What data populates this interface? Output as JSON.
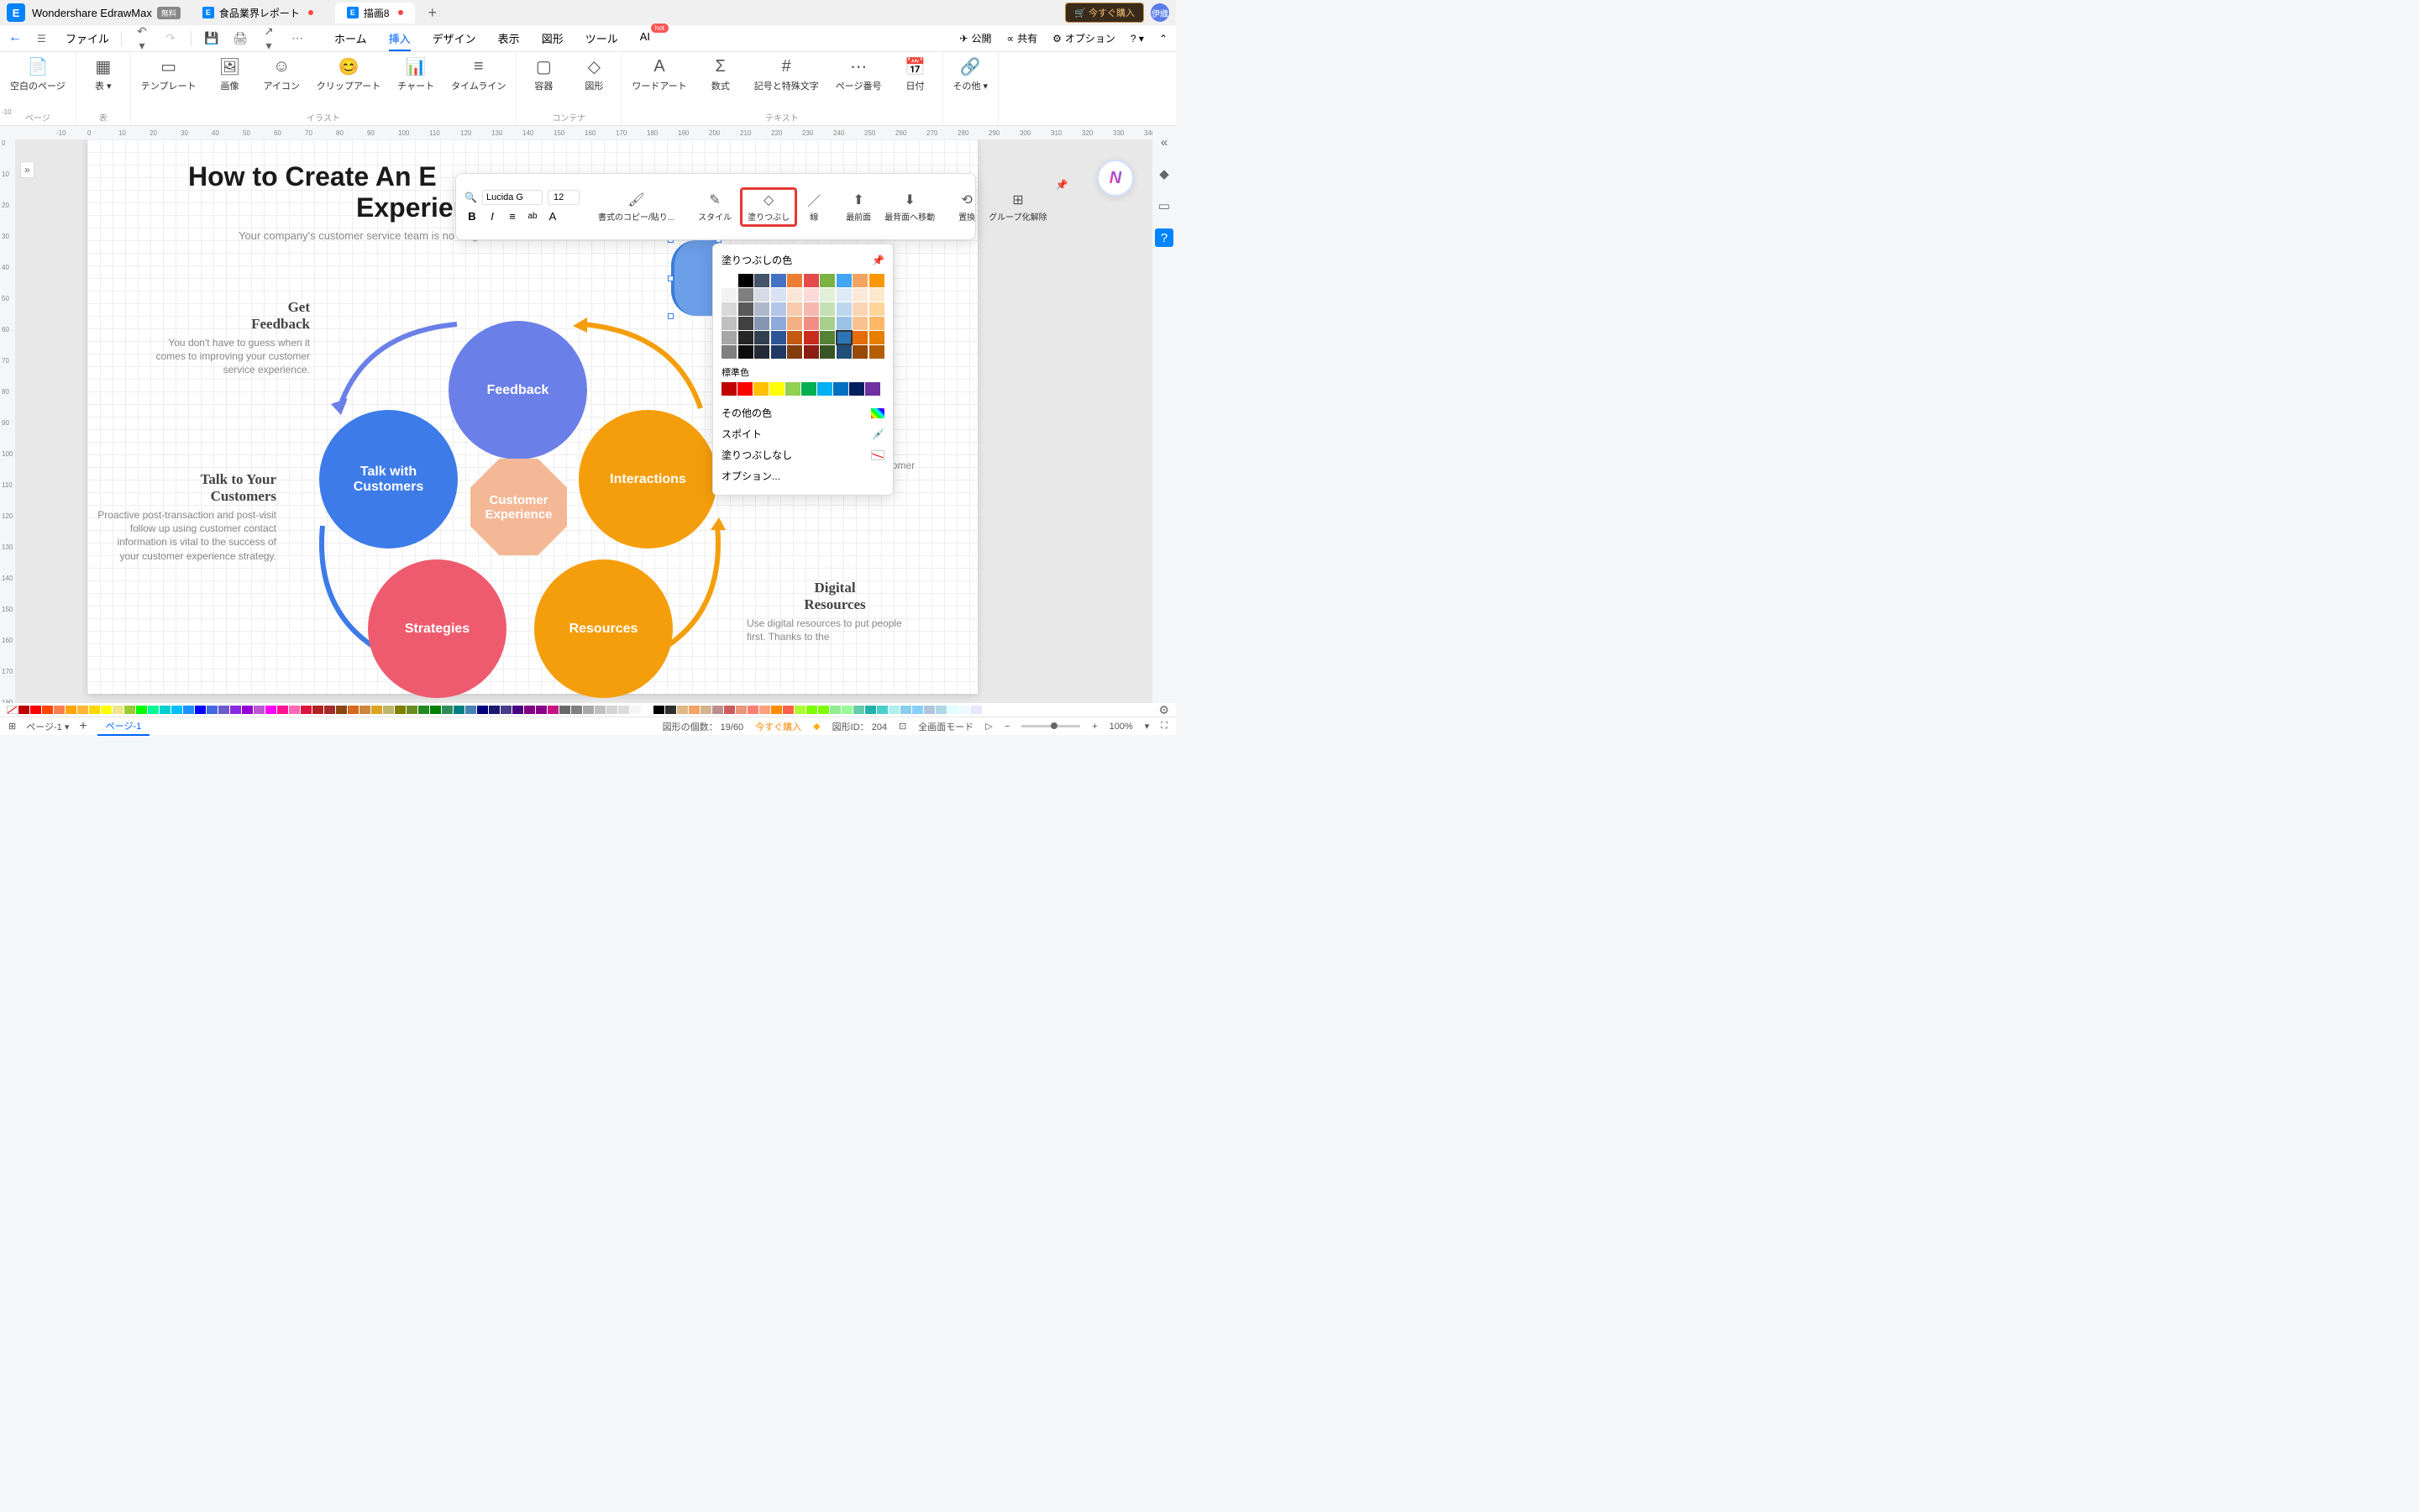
{
  "app": {
    "name": "Wondershare EdrawMax",
    "free_badge": "無料"
  },
  "tabs": [
    {
      "label": "食品業界レポート",
      "modified": true
    },
    {
      "label": "描画8",
      "modified": true
    }
  ],
  "titlebar_right": {
    "buy": "🛒 今すぐ購入",
    "user_initial": "伊織"
  },
  "menubar": {
    "file": "ファイル",
    "top_tabs": [
      "ホーム",
      "挿入",
      "デザイン",
      "表示",
      "図形",
      "ツール",
      "AI"
    ],
    "active_tab": "挿入",
    "ai_hot": "hot",
    "publish": "公開",
    "share": "共有",
    "options": "オプション"
  },
  "ribbon": {
    "groups": [
      {
        "label": "ページ",
        "items": [
          {
            "icon": "📄",
            "label": "空白のページ"
          }
        ]
      },
      {
        "label": "表",
        "items": [
          {
            "icon": "▦",
            "label": "表 ▾"
          }
        ]
      },
      {
        "label": "イラスト",
        "items": [
          {
            "icon": "▭",
            "label": "テンプレート"
          },
          {
            "icon": "🖼",
            "label": "画像"
          },
          {
            "icon": "☺",
            "label": "アイコン"
          },
          {
            "icon": "😊",
            "label": "クリップアート"
          },
          {
            "icon": "📊",
            "label": "チャート"
          },
          {
            "icon": "≡",
            "label": "タイムライン"
          }
        ]
      },
      {
        "label": "コンテナ",
        "items": [
          {
            "icon": "▢",
            "label": "容器"
          },
          {
            "icon": "◇",
            "label": "図形"
          }
        ]
      },
      {
        "label": "テキスト",
        "items": [
          {
            "icon": "A",
            "label": "ワードアート"
          },
          {
            "icon": "Σ",
            "label": "数式"
          },
          {
            "icon": "#",
            "label": "記号と特殊文字"
          },
          {
            "icon": "⋯",
            "label": "ページ番号"
          },
          {
            "icon": "📅",
            "label": "日付"
          }
        ]
      },
      {
        "label": "",
        "items": [
          {
            "icon": "🔗",
            "label": "その他 ▾"
          }
        ]
      }
    ]
  },
  "diagram": {
    "title": "How to Create An E",
    "title_line2": "Experience",
    "subtitle": "Your company's customer service team is no longer an added benefit that customers think a",
    "circles": {
      "feedback": "Feedback",
      "talk": "Talk with\nCustomers",
      "interactions": "Interactions",
      "strategies": "Strategies",
      "resources": "Resources",
      "center": "Customer\nExperience"
    },
    "side_texts": {
      "get_feedback": {
        "h": "Get\nFeedback",
        "p": "You don't have to guess when it comes to improving your customer service experience."
      },
      "talk_customers": {
        "h": "Talk to Your\nCustomers",
        "p": "Proactive post-transaction and post-visit follow up using customer contact information is vital to the success of your customer experience strategy."
      },
      "interactions_txt": {
        "p": "beginning and ending every customer interaction with a thank you"
      },
      "digital": {
        "h": "Digital\nResources",
        "p": "Use digital resources to put people first. Thanks to the"
      }
    }
  },
  "mini_toolbar": {
    "font": "Lucida G",
    "size": "12",
    "copy_fmt": "書式のコピー/貼り...",
    "style": "スタイル",
    "fill": "塗りつぶし",
    "line": "線",
    "front": "最前面",
    "back": "最背面へ移動",
    "replace": "置換",
    "ungroup": "グループ化解除"
  },
  "fill_panel": {
    "title": "塗りつぶしの色",
    "standard": "標準色",
    "other": "その他の色",
    "eyedrop": "スポイト",
    "none": "塗りつぶしなし",
    "options": "オプション...",
    "theme_colors": [
      [
        "#ffffff",
        "#000000",
        "#44546a",
        "#4472c4",
        "#ed7d31",
        "#e54b4b",
        "#7cb342",
        "#42a5f5",
        "#f4a460",
        "#ff9800"
      ],
      [
        "#f2f2f2",
        "#7f7f7f",
        "#d6dce5",
        "#d9e2f3",
        "#fbe5d6",
        "#fadbd7",
        "#e2efd9",
        "#deebf7",
        "#fde9d9",
        "#ffe8cc"
      ],
      [
        "#d9d9d9",
        "#595959",
        "#adb9ca",
        "#b4c6e7",
        "#f7cbac",
        "#f5b7b0",
        "#c5e0b4",
        "#bdd7ee",
        "#fbd4b4",
        "#ffd599"
      ],
      [
        "#bfbfbf",
        "#404040",
        "#8496b0",
        "#8eaadb",
        "#f4b183",
        "#f08e85",
        "#a8d08d",
        "#9cc3e6",
        "#fac090",
        "#ffb866"
      ],
      [
        "#a6a6a6",
        "#262626",
        "#323f4f",
        "#2f5496",
        "#c45911",
        "#c72c1d",
        "#538135",
        "#2e75b6",
        "#e46c0a",
        "#e67e00"
      ],
      [
        "#808080",
        "#0d0d0d",
        "#222a35",
        "#1f3864",
        "#833c0c",
        "#8a1e14",
        "#385623",
        "#1f4e79",
        "#984807",
        "#b35f00"
      ]
    ],
    "standard_colors": [
      "#c00000",
      "#ff0000",
      "#ffc000",
      "#ffff00",
      "#92d050",
      "#00b050",
      "#00b0f0",
      "#0070c0",
      "#002060",
      "#7030a0"
    ]
  },
  "statusbar": {
    "page_sel": "ページ-1",
    "page_tab": "ページ-1",
    "shapes_count_label": "図形の個数：",
    "shapes_count": "19/60",
    "buy_now": "今すぐ購入",
    "shape_id_label": "図形ID：",
    "shape_id": "204",
    "fullscreen": "全画面モード",
    "zoom": "100%"
  }
}
